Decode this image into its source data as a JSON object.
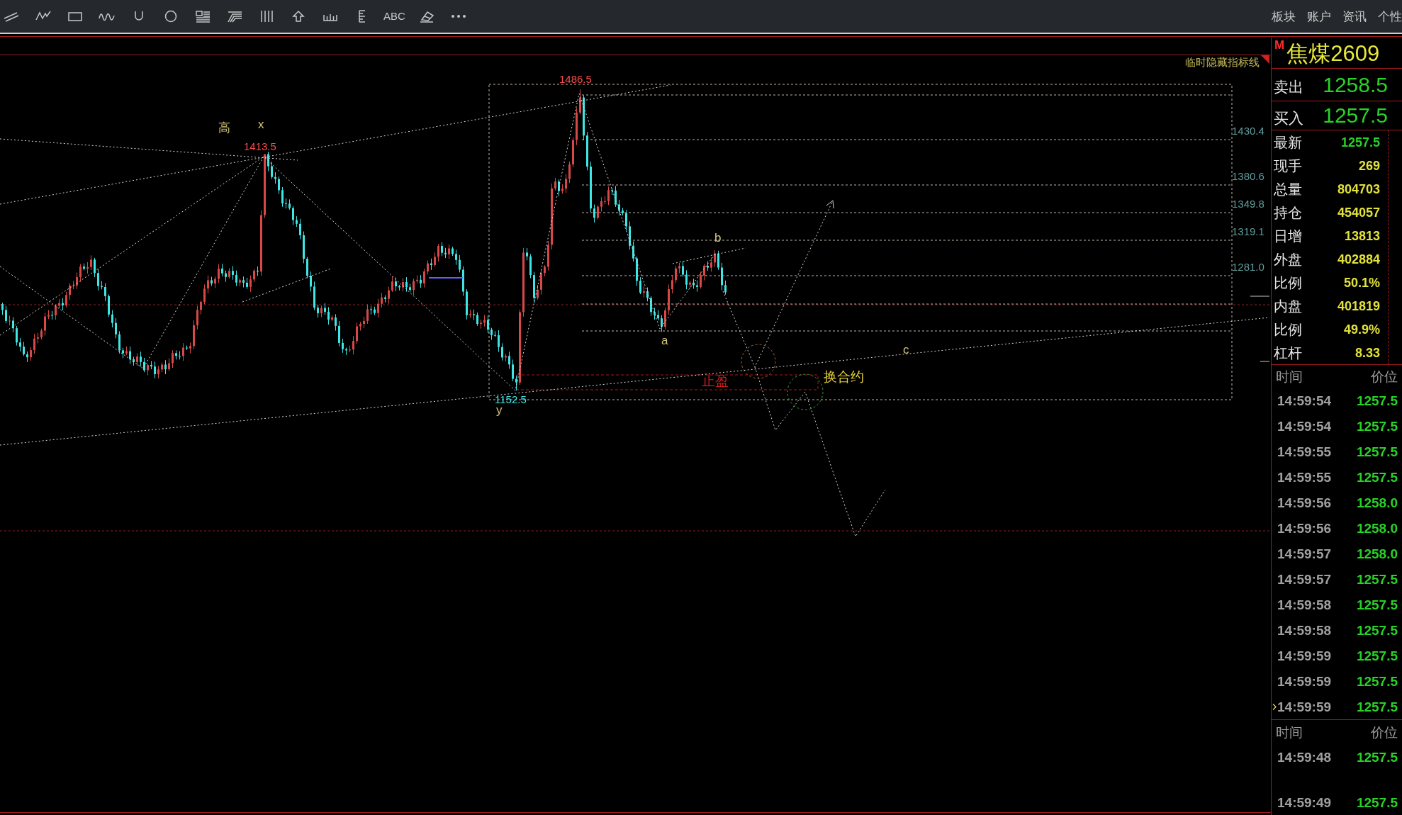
{
  "toolbar": {
    "text_tool": "ABC",
    "menu": [
      "板块",
      "账户",
      "资讯",
      "个性"
    ]
  },
  "chart": {
    "hide_lines_label": "临时隐藏指标线",
    "labels": [
      {
        "text": "1486.5",
        "kind": "high"
      },
      {
        "text": "高",
        "kind": "wave"
      },
      {
        "text": "x",
        "kind": "wave"
      },
      {
        "text": "1413.5",
        "kind": "high"
      },
      {
        "text": "b",
        "kind": "wave"
      },
      {
        "text": "a",
        "kind": "wave"
      },
      {
        "text": "c",
        "kind": "wave"
      },
      {
        "text": "止盈",
        "kind": "stop"
      },
      {
        "text": "换合约",
        "kind": "note"
      },
      {
        "text": "1152.5",
        "kind": "low"
      },
      {
        "text": "y",
        "kind": "wave"
      }
    ],
    "fib_levels": [
      "1430.4",
      "1380.6",
      "1349.8",
      "1319.1",
      "1281.0"
    ]
  },
  "quote": {
    "market": "M",
    "symbol": "焦煤2609",
    "ask": {
      "label": "卖出",
      "value": "1258.5"
    },
    "bid": {
      "label": "买入",
      "value": "1257.5"
    },
    "stats": [
      {
        "label": "最新",
        "value": "1257.5",
        "kind": "price"
      },
      {
        "label": "现手",
        "value": "269",
        "kind": "number"
      },
      {
        "label": "总量",
        "value": "804703",
        "kind": "number"
      },
      {
        "label": "持仓",
        "value": "454057",
        "kind": "number"
      },
      {
        "label": "日增",
        "value": "13813",
        "kind": "number"
      },
      {
        "label": "外盘",
        "value": "402884",
        "kind": "number"
      },
      {
        "label": "比例",
        "value": "50.1%",
        "kind": "number"
      },
      {
        "label": "内盘",
        "value": "401819",
        "kind": "number"
      },
      {
        "label": "比例",
        "value": "49.9%",
        "kind": "number"
      },
      {
        "label": "杠杆",
        "value": "8.33",
        "kind": "number"
      }
    ]
  },
  "trades": {
    "columns": [
      "时间",
      "价位"
    ],
    "rows": [
      {
        "time": "14:59:54",
        "price": "1257.5",
        "selected": false
      },
      {
        "time": "14:59:54",
        "price": "1257.5",
        "selected": false
      },
      {
        "time": "14:59:55",
        "price": "1257.5",
        "selected": false
      },
      {
        "time": "14:59:55",
        "price": "1257.5",
        "selected": false
      },
      {
        "time": "14:59:56",
        "price": "1258.0",
        "selected": false
      },
      {
        "time": "14:59:56",
        "price": "1258.0",
        "selected": false
      },
      {
        "time": "14:59:57",
        "price": "1258.0",
        "selected": false
      },
      {
        "time": "14:59:57",
        "price": "1257.5",
        "selected": false
      },
      {
        "time": "14:59:58",
        "price": "1257.5",
        "selected": false
      },
      {
        "time": "14:59:58",
        "price": "1257.5",
        "selected": false
      },
      {
        "time": "14:59:59",
        "price": "1257.5",
        "selected": false
      },
      {
        "time": "14:59:59",
        "price": "1257.5",
        "selected": false
      },
      {
        "time": "14:59:59",
        "price": "1257.5",
        "selected": true
      }
    ]
  },
  "trades_2": {
    "columns": [
      "时间",
      "价位"
    ],
    "rows": [
      {
        "time": "14:59:48",
        "price": "1257.5"
      },
      {
        "time": "14:59:49",
        "price": "1257.5"
      }
    ]
  }
}
